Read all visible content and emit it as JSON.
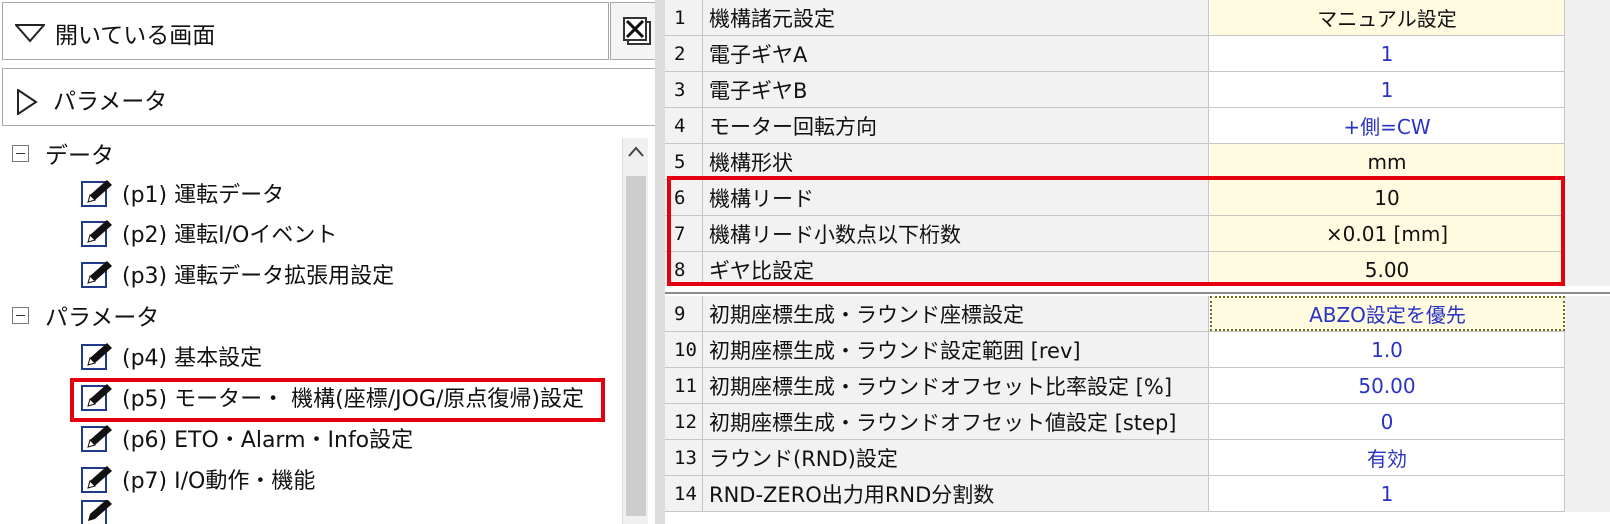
{
  "left_panel": {
    "open_screens_label": "開いている画面",
    "parameter_header_label": "パラメータ",
    "tree": {
      "data_category": "データ",
      "data_items": [
        "(p1) 運転データ",
        "(p2) 運転I/Oイベント",
        "(p3) 運転データ拡張用設定"
      ],
      "param_category": "パラメータ",
      "param_items": [
        "(p4) 基本設定",
        "(p5) モーター・ 機構(座標/JOG/原点復帰)設定",
        "(p6) ETO・Alarm・Info設定",
        "(p7) I/O動作・機能"
      ],
      "highlighted_item": "(p5) モーター・ 機構(座標/JOG/原点復帰)設定"
    }
  },
  "parameter_table": {
    "rows": [
      {
        "no": "1",
        "name": "機構諸元設定",
        "value": "マニュアル設定"
      },
      {
        "no": "2",
        "name": "電子ギヤA",
        "value": "1"
      },
      {
        "no": "3",
        "name": "電子ギヤB",
        "value": "1"
      },
      {
        "no": "4",
        "name": "モーター回転方向",
        "value": "+側=CW"
      },
      {
        "no": "5",
        "name": "機構形状",
        "value": "mm"
      },
      {
        "no": "6",
        "name": "機構リード",
        "value": "10"
      },
      {
        "no": "7",
        "name": "機構リード小数点以下桁数",
        "value": "×0.01 [mm]"
      },
      {
        "no": "8",
        "name": "ギヤ比設定",
        "value": "5.00"
      },
      {
        "no": "9",
        "name": "初期座標生成・ラウンド座標設定",
        "value": "ABZO設定を優先"
      },
      {
        "no": "10",
        "name": "初期座標生成・ラウンド設定範囲 [rev]",
        "value": "1.0"
      },
      {
        "no": "11",
        "name": "初期座標生成・ラウンドオフセット比率設定 [%]",
        "value": "50.00"
      },
      {
        "no": "12",
        "name": "初期座標生成・ラウンドオフセット値設定 [step]",
        "value": "0"
      },
      {
        "no": "13",
        "name": "ラウンド(RND)設定",
        "value": "有効"
      },
      {
        "no": "14",
        "name": "RND-ZERO出力用RND分割数",
        "value": "1"
      }
    ],
    "highlighted_rows": [
      "6",
      "7",
      "8"
    ]
  },
  "colors": {
    "highlight": "#e4000f",
    "value_text": "#2933c4",
    "value_background": "#fffbe0",
    "icon_pencil": "#1f3a8a"
  }
}
